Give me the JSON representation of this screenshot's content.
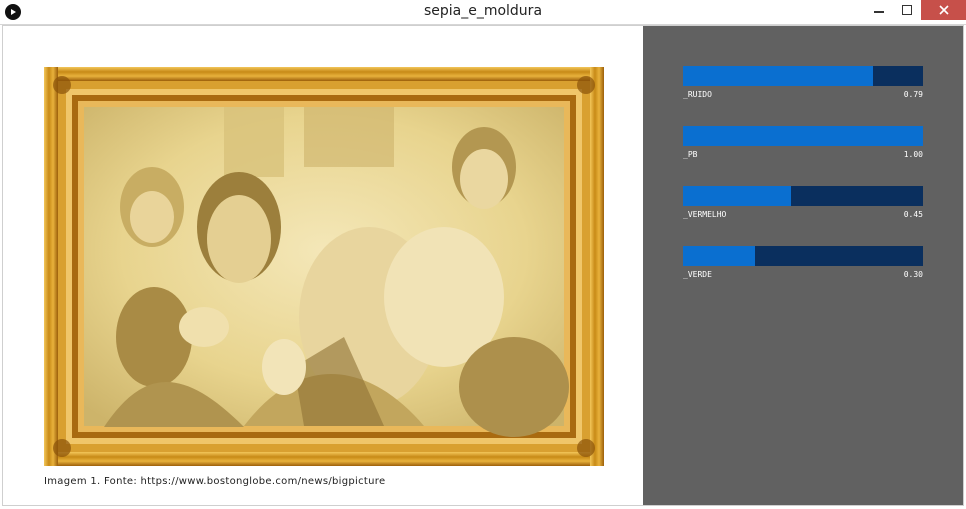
{
  "window": {
    "title": "sepia_e_moldura",
    "close_color": "#c7504a"
  },
  "canvas": {
    "caption": "Imagem 1. Fonte: https://www.bostonglobe.com/news/bigpicture",
    "image_icon": "sepia-photo-in-gold-frame"
  },
  "panel": {
    "background": "#616161",
    "sliders": [
      {
        "label": "_RUIDO",
        "value": "0.79",
        "fraction": 0.79
      },
      {
        "label": "_PB",
        "value": "1.00",
        "fraction": 1.0
      },
      {
        "label": "_VERMELHO",
        "value": "0.45",
        "fraction": 0.45
      },
      {
        "label": "_VERDE",
        "value": "0.30",
        "fraction": 0.3
      }
    ],
    "track_color": "#0a2f5e",
    "fill_color": "#0a6fd0"
  }
}
